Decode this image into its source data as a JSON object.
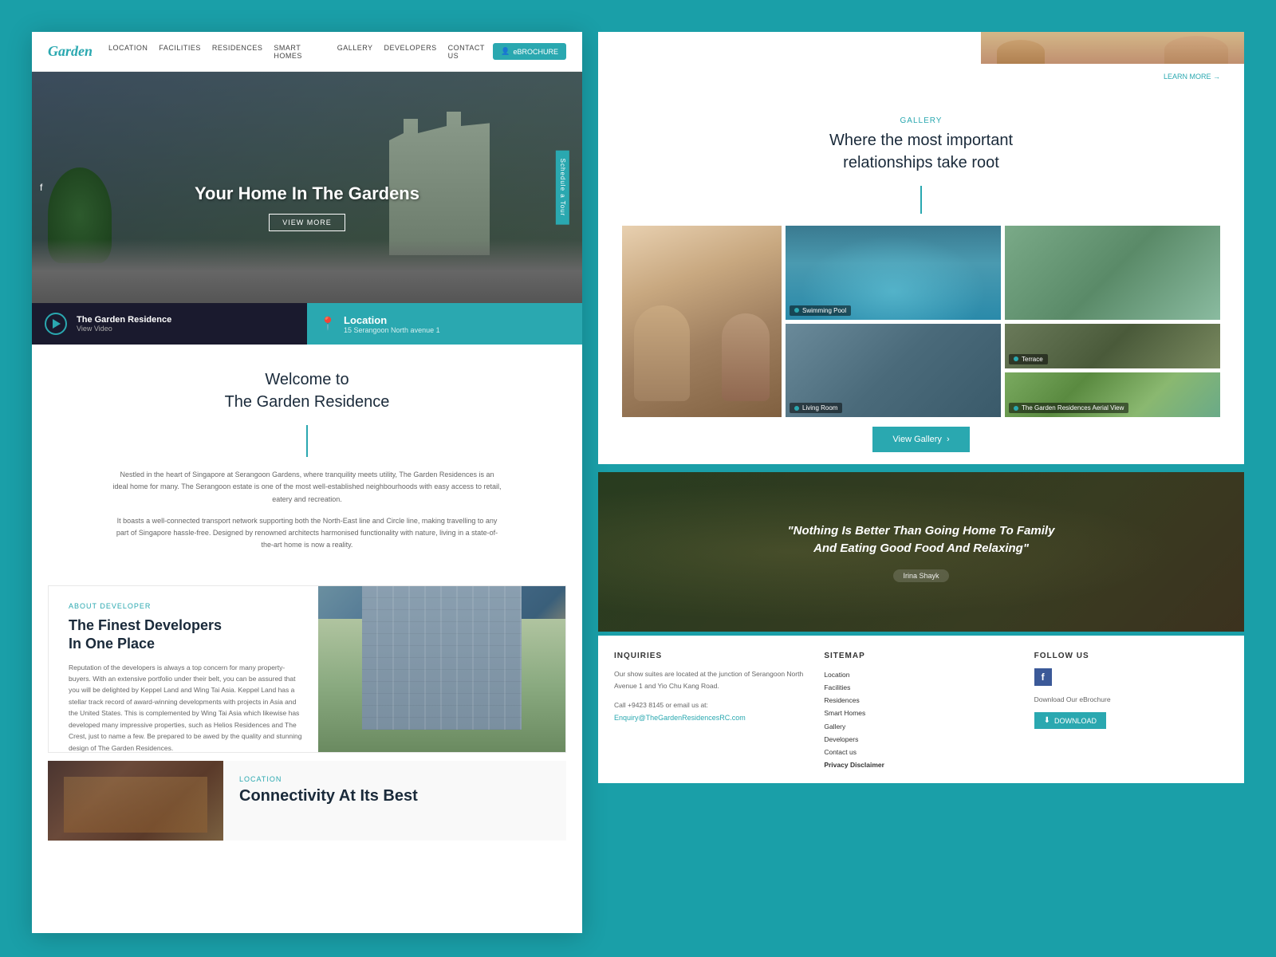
{
  "colors": {
    "teal": "#2aa8b0",
    "dark": "#1a2a3a",
    "white": "#ffffff",
    "gray": "#666666"
  },
  "nav": {
    "logo": "Garden",
    "links": [
      "LOCATION",
      "FACILITIES",
      "RESIDENCES",
      "SMART HOMES",
      "GALLERY",
      "DEVELOPERS",
      "CONTACT US"
    ],
    "brochure_label": "eBROCHURE"
  },
  "hero": {
    "title": "Your Home In The Gardens",
    "btn_label": "VIEW MORE",
    "schedule_label": "Schedule a Tour",
    "video_title": "The Garden Residence",
    "video_subtitle": "View Video",
    "location_label": "Location",
    "location_address": "15 Serangoon North avenue 1"
  },
  "welcome": {
    "heading_line1": "Welcome to",
    "heading_line2": "The Garden Residence",
    "para1": "Nestled in the heart of Singapore at Serangoon Gardens, where tranquility meets utility, The Garden Residences is an ideal home for many. The Serangoon estate is one of the most well-established neighbourhoods with easy access to retail, eatery and recreation.",
    "para2": "It boasts a well-connected transport network supporting both the North-East line and Circle line, making travelling to any part of Singapore hassle-free. Designed by renowned architects harmonised functionality with nature, living in a state-of-the-art home is now a reality."
  },
  "developer": {
    "about_label": "About Developer",
    "title_line1": "The Finest Developers",
    "title_line2": "In One Place",
    "text": "Reputation of the developers is always a top concern for many property-buyers. With an extensive portfolio under their belt, you can be assured that you will be delighted by Keppel Land and Wing Tai Asia. Keppel Land has a stellar track record of award-winning developments with projects in Asia and the United States. This is complemented by Wing Tai Asia which likewise has developed many impressive properties, such as Helios Residences and The Crest, just to name a few. Be prepared to be awed by the quality and stunning design of The Garden Residences.",
    "learn_more": "LEARN MORE →"
  },
  "location_section": {
    "label": "Location",
    "title": "Connectivity At Its Best"
  },
  "gallery": {
    "label": "Gallery",
    "title_line1": "Where the most important",
    "title_line2": "relationships take root",
    "cells": [
      {
        "label": "Swimming Pool",
        "id": "pool"
      },
      {
        "label": "Living Room",
        "id": "living"
      },
      {
        "label": "Terrace",
        "id": "terrace"
      },
      {
        "label": "The Garden Residences Aerial View",
        "id": "aerial"
      }
    ],
    "view_gallery_btn": "View Gallery"
  },
  "quote": {
    "text": "\"Nothing Is Better Than Going Home To Family And Eating Good Food And Relaxing\"",
    "author": "Irina Shayk"
  },
  "footer": {
    "inquiries": {
      "title": "INQUIRIES",
      "text1": "Our show suites are located at the junction of Serangoon North Avenue 1 and Yio Chu Kang Road.",
      "phone": "Call +9423 8145 or email us at:",
      "email": "Enquiry@TheGardenResidencesRC.com"
    },
    "sitemap": {
      "title": "SITEMAP",
      "links": [
        "Location",
        "Facilities",
        "Residences",
        "Smart Homes",
        "Gallery",
        "Developers",
        "Contact us",
        "Privacy Disclaimer"
      ]
    },
    "follow": {
      "title": "FOLLOW US",
      "download_label": "DOWNLOAD"
    }
  },
  "learn_more_top": "LEARN MORE →"
}
